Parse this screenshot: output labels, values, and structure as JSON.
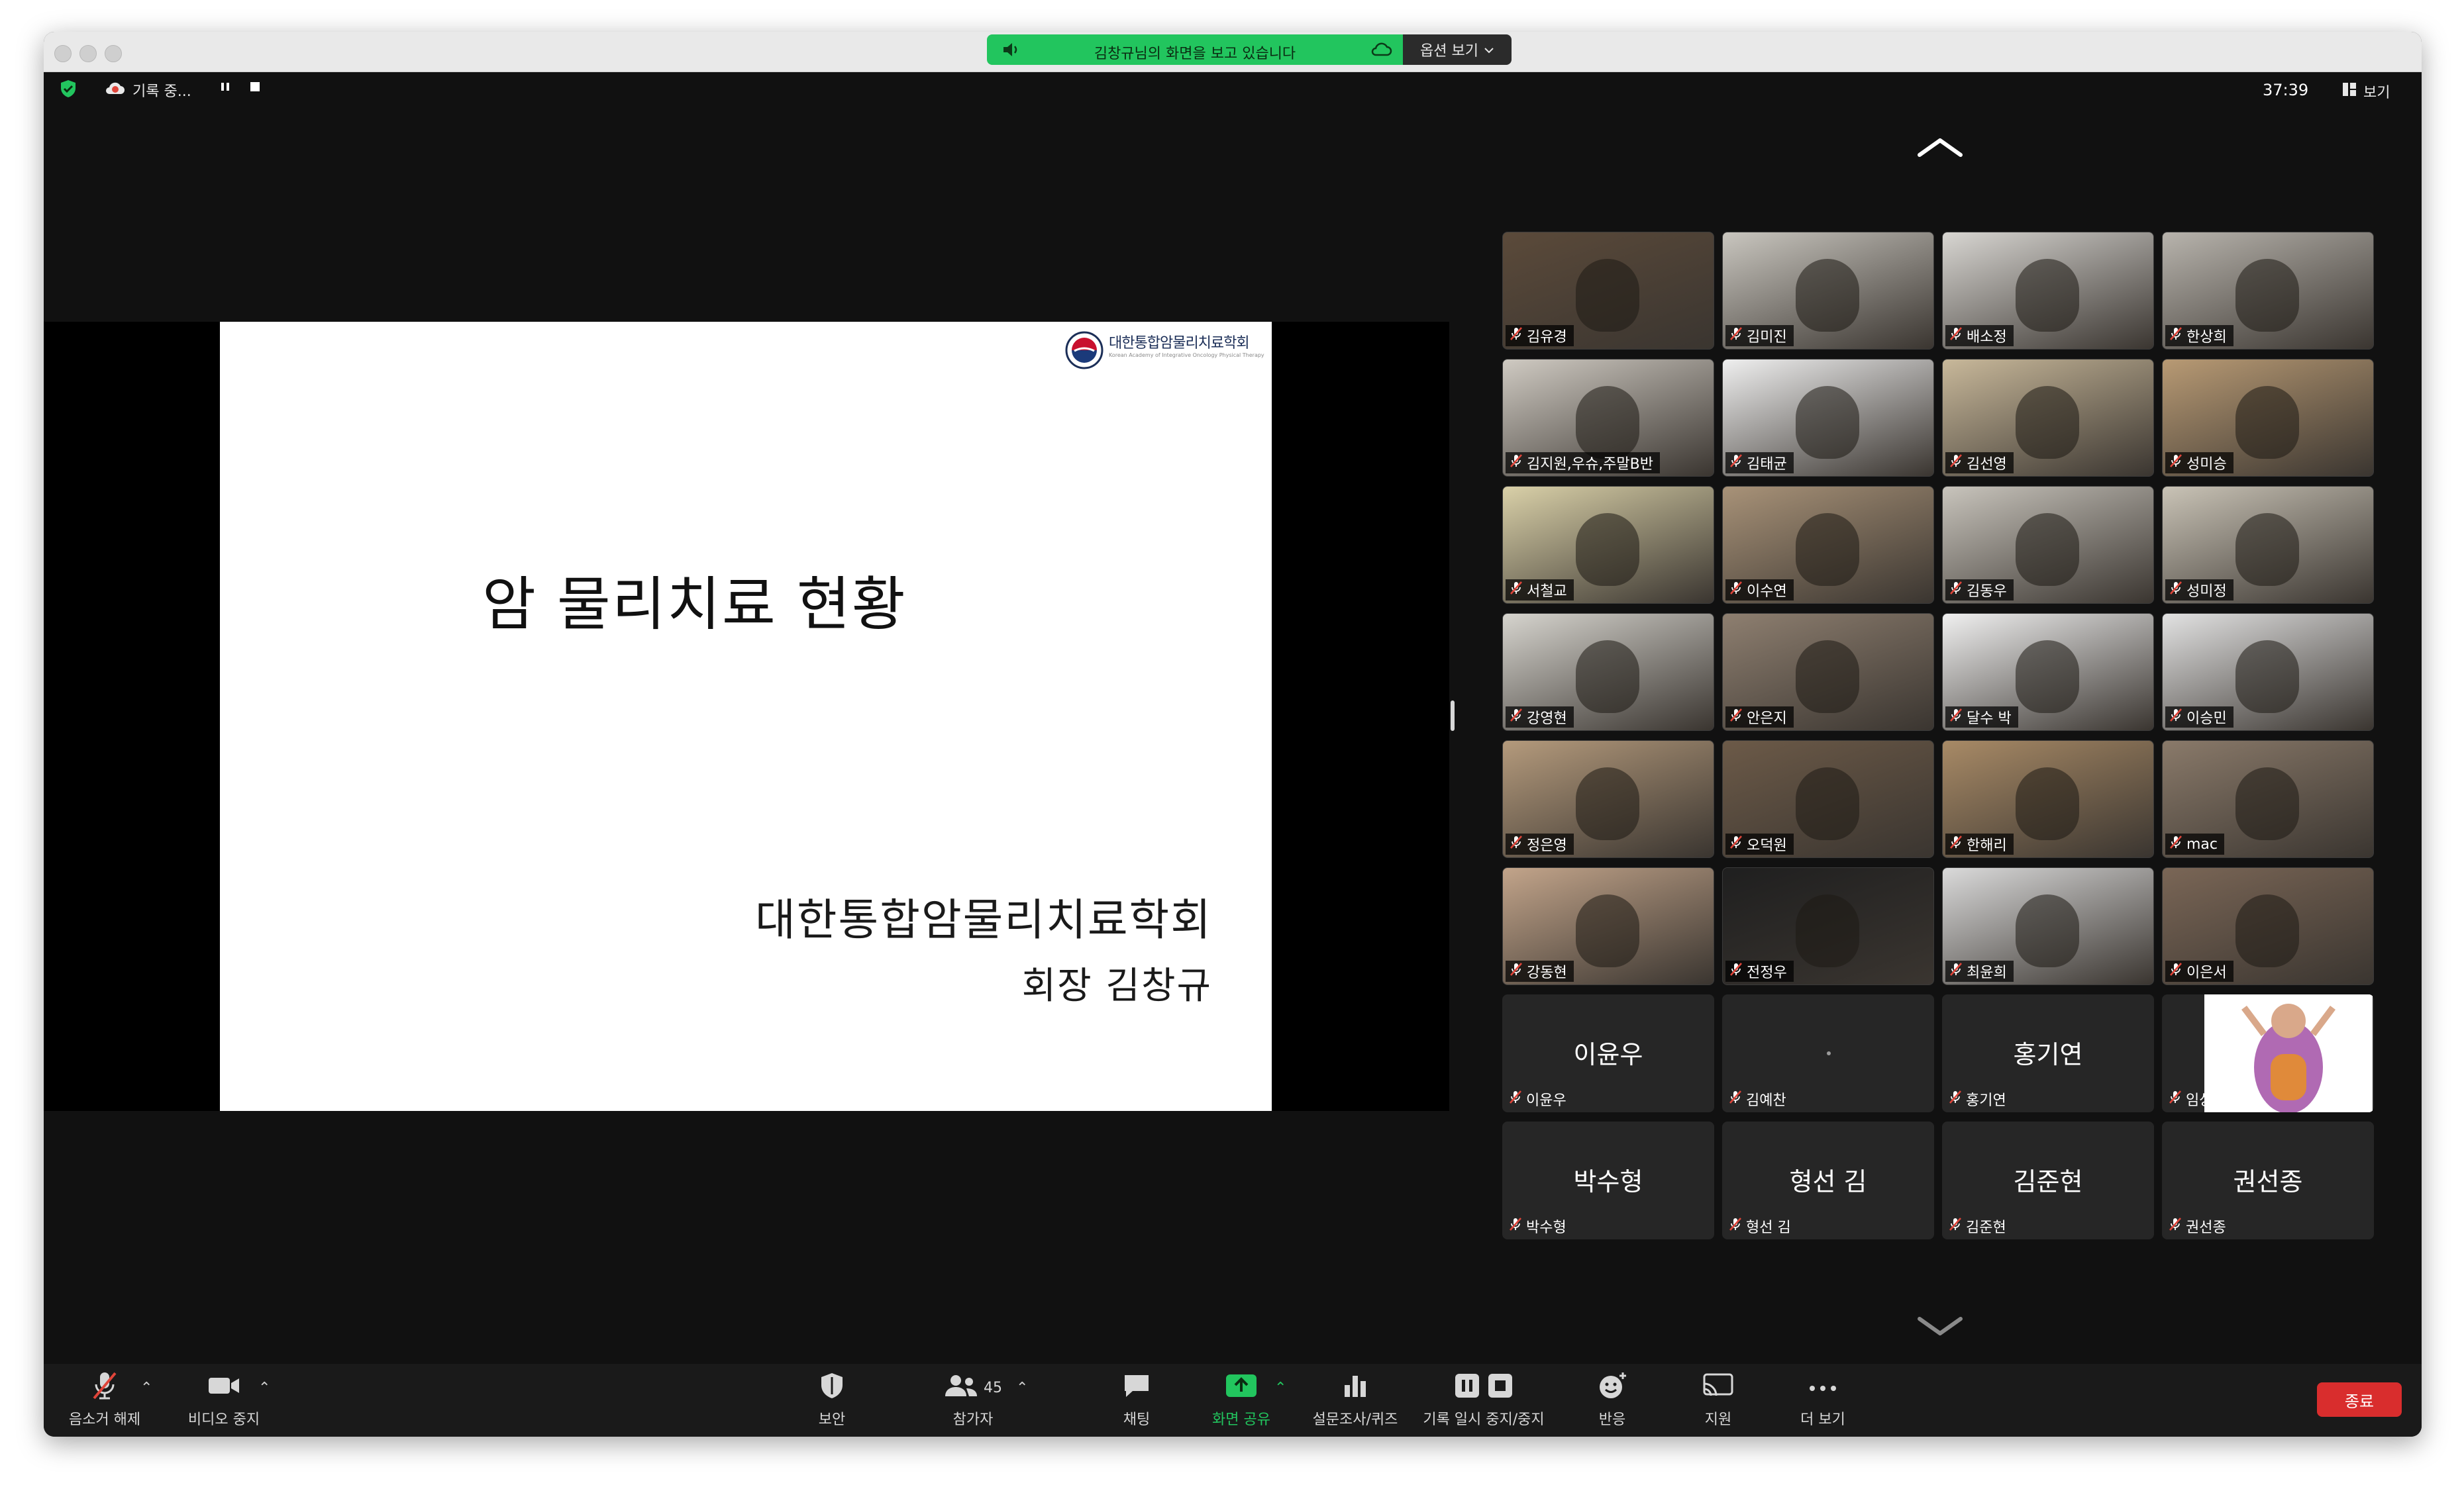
{
  "window": {
    "share_banner": "김창규님의 화면을 보고 있습니다",
    "options_label": "옵션 보기"
  },
  "topbar": {
    "recording_label": "기록 중...",
    "timer": "37:39",
    "view_label": "보기"
  },
  "slide": {
    "logo_text": "대한통합암물리치료학회",
    "logo_subtext": "Korean Academy of Integrative Oncology Physical Therapy",
    "title": "암 물리치료 현황",
    "organization": "대한통합암물리치료학회",
    "presenter": "회장 김창규"
  },
  "participants": [
    {
      "name": "김유경",
      "type": "video",
      "bg": "#5b4a3a"
    },
    {
      "name": "김미진",
      "type": "video",
      "bg": "#c9c6bf"
    },
    {
      "name": "배소정",
      "type": "video",
      "bg": "#d8d6d2"
    },
    {
      "name": "한상희",
      "type": "video",
      "bg": "#b8b4ad"
    },
    {
      "name": "김지원,우슈,주말B반",
      "type": "video",
      "bg": "#cfcac2"
    },
    {
      "name": "김태균",
      "type": "video",
      "bg": "#efefef"
    },
    {
      "name": "김선영",
      "type": "video",
      "bg": "#c8b89a"
    },
    {
      "name": "성미승",
      "type": "video",
      "bg": "#b89a74"
    },
    {
      "name": "서철교",
      "type": "video",
      "bg": "#d9d0a8"
    },
    {
      "name": "이수연",
      "type": "video",
      "bg": "#a89278"
    },
    {
      "name": "김동우",
      "type": "video",
      "bg": "#c8c4bc"
    },
    {
      "name": "성미정",
      "type": "video",
      "bg": "#c9c3b6"
    },
    {
      "name": "강영현",
      "type": "video",
      "bg": "#d6d4ce"
    },
    {
      "name": "안은지",
      "type": "video",
      "bg": "#8e7f70"
    },
    {
      "name": "달수 박",
      "type": "video",
      "bg": "#f0f0f0"
    },
    {
      "name": "이승민",
      "type": "video",
      "bg": "#e2e2e2"
    },
    {
      "name": "정은영",
      "type": "video",
      "bg": "#b49a7c"
    },
    {
      "name": "오덕원",
      "type": "video",
      "bg": "#6c5a48"
    },
    {
      "name": "한해리",
      "type": "video",
      "bg": "#a88a66"
    },
    {
      "name": "mac",
      "type": "video",
      "bg": "#8a7a6a"
    },
    {
      "name": "강동현",
      "type": "video",
      "bg": "#c2a48a"
    },
    {
      "name": "전정우",
      "type": "video",
      "bg": "#1f1f1f"
    },
    {
      "name": "최윤희",
      "type": "video",
      "bg": "#dadada"
    },
    {
      "name": "이은서",
      "type": "video",
      "bg": "#7a6656"
    },
    {
      "name": "이윤우",
      "type": "name"
    },
    {
      "name": "김예찬",
      "type": "dot"
    },
    {
      "name": "홍기연",
      "type": "name"
    },
    {
      "name": "임상원",
      "type": "avatar"
    },
    {
      "name": "박수형",
      "type": "name"
    },
    {
      "name": "형선 김",
      "type": "name"
    },
    {
      "name": "김준현",
      "type": "name"
    },
    {
      "name": "권선종",
      "type": "name"
    }
  ],
  "toolbar": {
    "unmute": "음소거 해제",
    "stop_video": "비디오 중지",
    "security": "보안",
    "participants": "참가자",
    "participant_count": "45",
    "chat": "채팅",
    "share_screen": "화면 공유",
    "polls": "설문조사/퀴즈",
    "recording": "기록 일시 중지/중지",
    "reactions": "반응",
    "support": "지원",
    "more": "더 보기",
    "end": "종료"
  },
  "colors": {
    "share_green": "#22c55e",
    "end_red": "#d92d2d",
    "mute_red": "#e0453a",
    "background": "#111111"
  }
}
